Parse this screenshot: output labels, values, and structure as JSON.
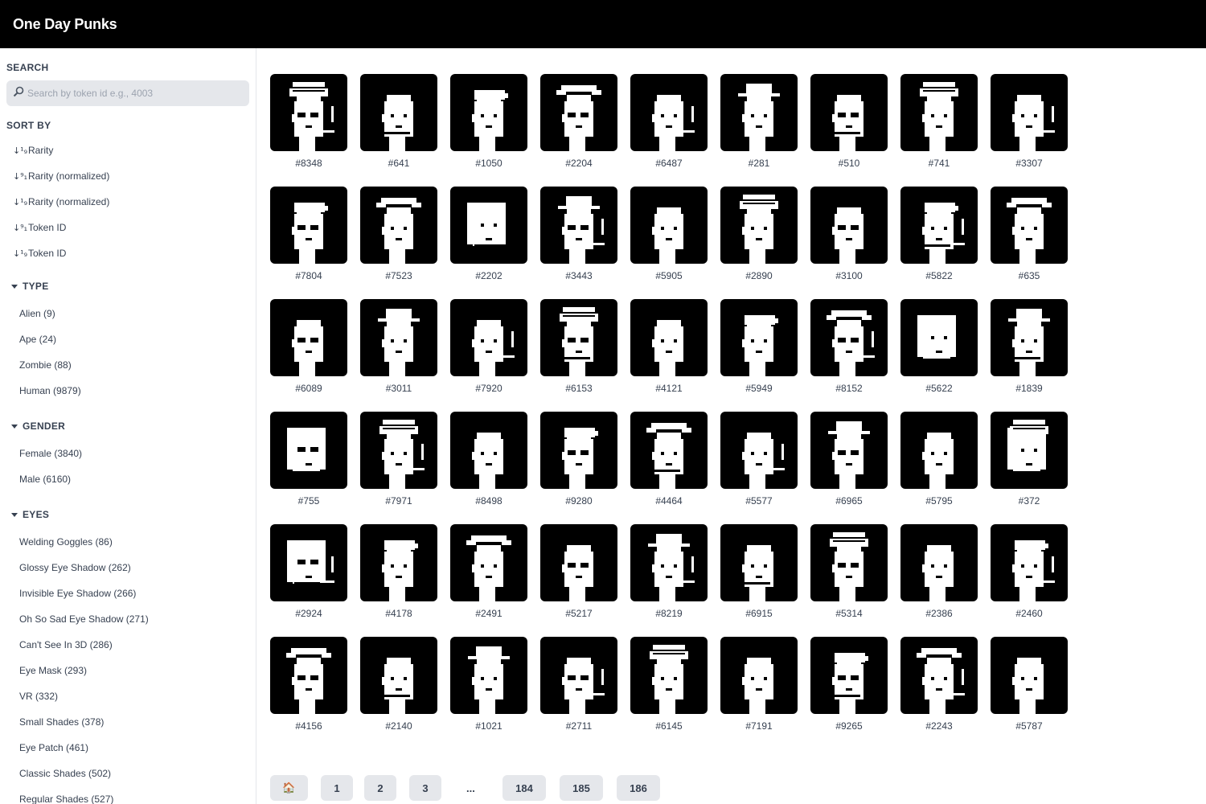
{
  "app": {
    "title": "One Day Punks"
  },
  "search": {
    "label": "SEARCH",
    "placeholder": "Search by token id e.g., 4003",
    "icon": "search-icon"
  },
  "sort": {
    "label": "SORT BY",
    "items": [
      {
        "label": "Rarity",
        "icon": "sort-ascending-icon"
      },
      {
        "label": "Rarity (normalized)",
        "icon": "sort-descending-icon"
      },
      {
        "label": "Rarity (normalized)",
        "icon": "sort-ascending-icon"
      },
      {
        "label": "Token ID",
        "icon": "sort-descending-icon"
      },
      {
        "label": "Token ID",
        "icon": "sort-ascending-icon"
      }
    ]
  },
  "filters": [
    {
      "label": "TYPE",
      "items": [
        "Alien (9)",
        "Ape (24)",
        "Zombie (88)",
        "Human (9879)"
      ]
    },
    {
      "label": "GENDER",
      "items": [
        "Female (3840)",
        "Male (6160)"
      ]
    },
    {
      "label": "EYES",
      "items": [
        "Welding Goggles (86)",
        "Glossy Eye Shadow (262)",
        "Invisible Eye Shadow (266)",
        "Oh So Sad Eye Shadow (271)",
        "Can't See In 3D (286)",
        "Eye Mask (293)",
        "VR (332)",
        "Small Shades (378)",
        "Eye Patch (461)",
        "Classic Shades (502)",
        "Regular Shades (527)"
      ]
    }
  ],
  "tokens": [
    "#8348",
    "#641",
    "#1050",
    "#2204",
    "#6487",
    "#281",
    "#510",
    "#741",
    "#3307",
    "#7804",
    "#7523",
    "#2202",
    "#3443",
    "#5905",
    "#2890",
    "#3100",
    "#5822",
    "#635",
    "#6089",
    "#3011",
    "#7920",
    "#6153",
    "#4121",
    "#5949",
    "#8152",
    "#5622",
    "#1839",
    "#755",
    "#7971",
    "#8498",
    "#9280",
    "#4464",
    "#5577",
    "#6965",
    "#5795",
    "#372",
    "#2924",
    "#4178",
    "#2491",
    "#5217",
    "#8219",
    "#6915",
    "#5314",
    "#2386",
    "#2460",
    "#4156",
    "#2140",
    "#1021",
    "#2711",
    "#6145",
    "#7191",
    "#9265",
    "#2243",
    "#5787"
  ],
  "pagination": {
    "home_icon": "home-icon",
    "home_glyph": "🏠",
    "pages": [
      "1",
      "2",
      "3"
    ],
    "ellipsis": "...",
    "last_pages": [
      "184",
      "185",
      "186"
    ]
  },
  "colors": {
    "topbar": "#000000",
    "button_bg": "#e5e7eb",
    "punk_bg": "#000000",
    "punk_fg": "#ffffff"
  }
}
